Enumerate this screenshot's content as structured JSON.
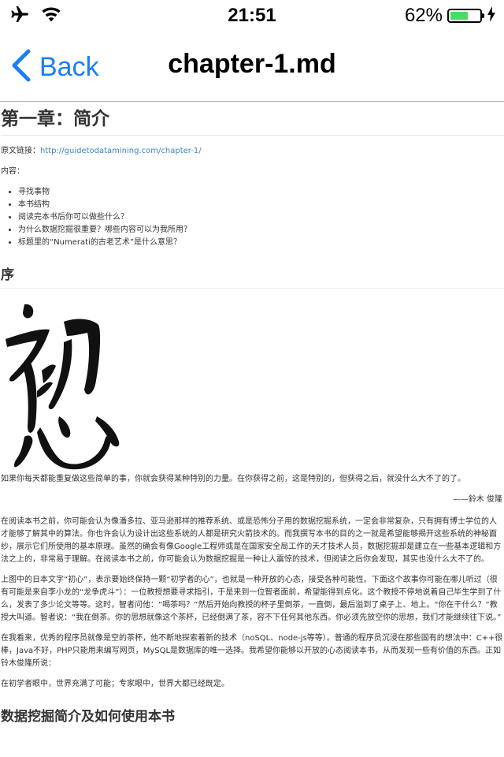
{
  "status_bar": {
    "time": "21:51",
    "battery_percent": "62%",
    "battery_level": 0.62,
    "icons": [
      "airplane-icon",
      "wifi-icon",
      "battery-icon",
      "charging-icon"
    ]
  },
  "nav": {
    "back_label": "Back",
    "title": "chapter-1.md"
  },
  "doc": {
    "h1": "第一章：简介",
    "source_label": "原文链接：",
    "source_link": "http://guidetodatamining.com/chapter-1/",
    "contents_label": "内容：",
    "toc": [
      "寻找事物",
      "本书结构",
      "阅读完本书后你可以做些什么？",
      "为什么数据挖掘很重要？哪些内容可以为我所用？",
      "标题里的“Numerati的古老艺术”是什么意思？"
    ],
    "h2_preface": "序",
    "quote": "如果你每天都能重复做这些简单的事，你就会获得某种特别的力量。在你获得之前，这是特别的，但获得之后，就没什么大不了的了。",
    "quote_author": "——鈴木 俊隆",
    "para1": "在阅读本书之前，你可能会认为像潘多拉、亚马逊那样的推荐系统、或是恐怖分子用的数据挖掘系统，一定会非常复杂，只有拥有博士学位的人才能够了解其中的算法。你也许会认为设计出这些系统的人都是研究火箭技术的。而我撰写本书的目的之一就是希望能够揭开这些系统的神秘面纱，展示它们所使用的基本原理。虽然的确会有像Google工程师或是在国家安全局工作的天才技术人员，数据挖掘却是建立在一些基本逻辑和方法之上的，非常易于理解。在阅读本书之前，你可能会认为数据挖掘是一种让人震惊的技术，但阅读之后你会发现，其实也没什么大不了的。",
    "para2": "上图中的日本文字“初心”，表示要始终保持一颗“初学者的心”，也就是一种开放的心态，接受各种可能性。下面这个故事你可能在哪儿听过（很有可能是来自李小龙的“龙争虎斗”）：一位教授想要寻求指引，于是来到一位智者面前，希望能得到点化。这个教授不停地说着自己毕生学到了什么，发表了多少论文等等。这时，智者问他：“喝茶吗？”然后开始向教授的杯子里倒茶，一直倒，最后溢到了桌子上、地上。“你在干什么？”教授大叫道。智者说：“我在倒茶。你的思想就像这个茶杯，已经倒满了茶，容不下任何其他东西。你必须先放空你的思想，我们才能继续往下说。”",
    "para3": "在我看来，优秀的程序员就像是空的茶杯，他不断地探索着新的技术（noSQL、node-js等等）。普通的程序员沉浸在那些固有的想法中：C++很棒，Java不好，PHP只能用来编写网页，MySQL是数据库的唯一选择。我希望你能够以开放的心态阅读本书，从而发现一些有价值的东西。正如铃木俊隆所说：",
    "para4": "在初学者眼中，世界充满了可能；专家眼中，世界大都已经既定。",
    "h2_next": "数据挖掘简介及如何使用本书"
  },
  "colors": {
    "ios_blue": "#1a7ff7",
    "link": "#4183c4",
    "battery_green": "#4cd964"
  }
}
